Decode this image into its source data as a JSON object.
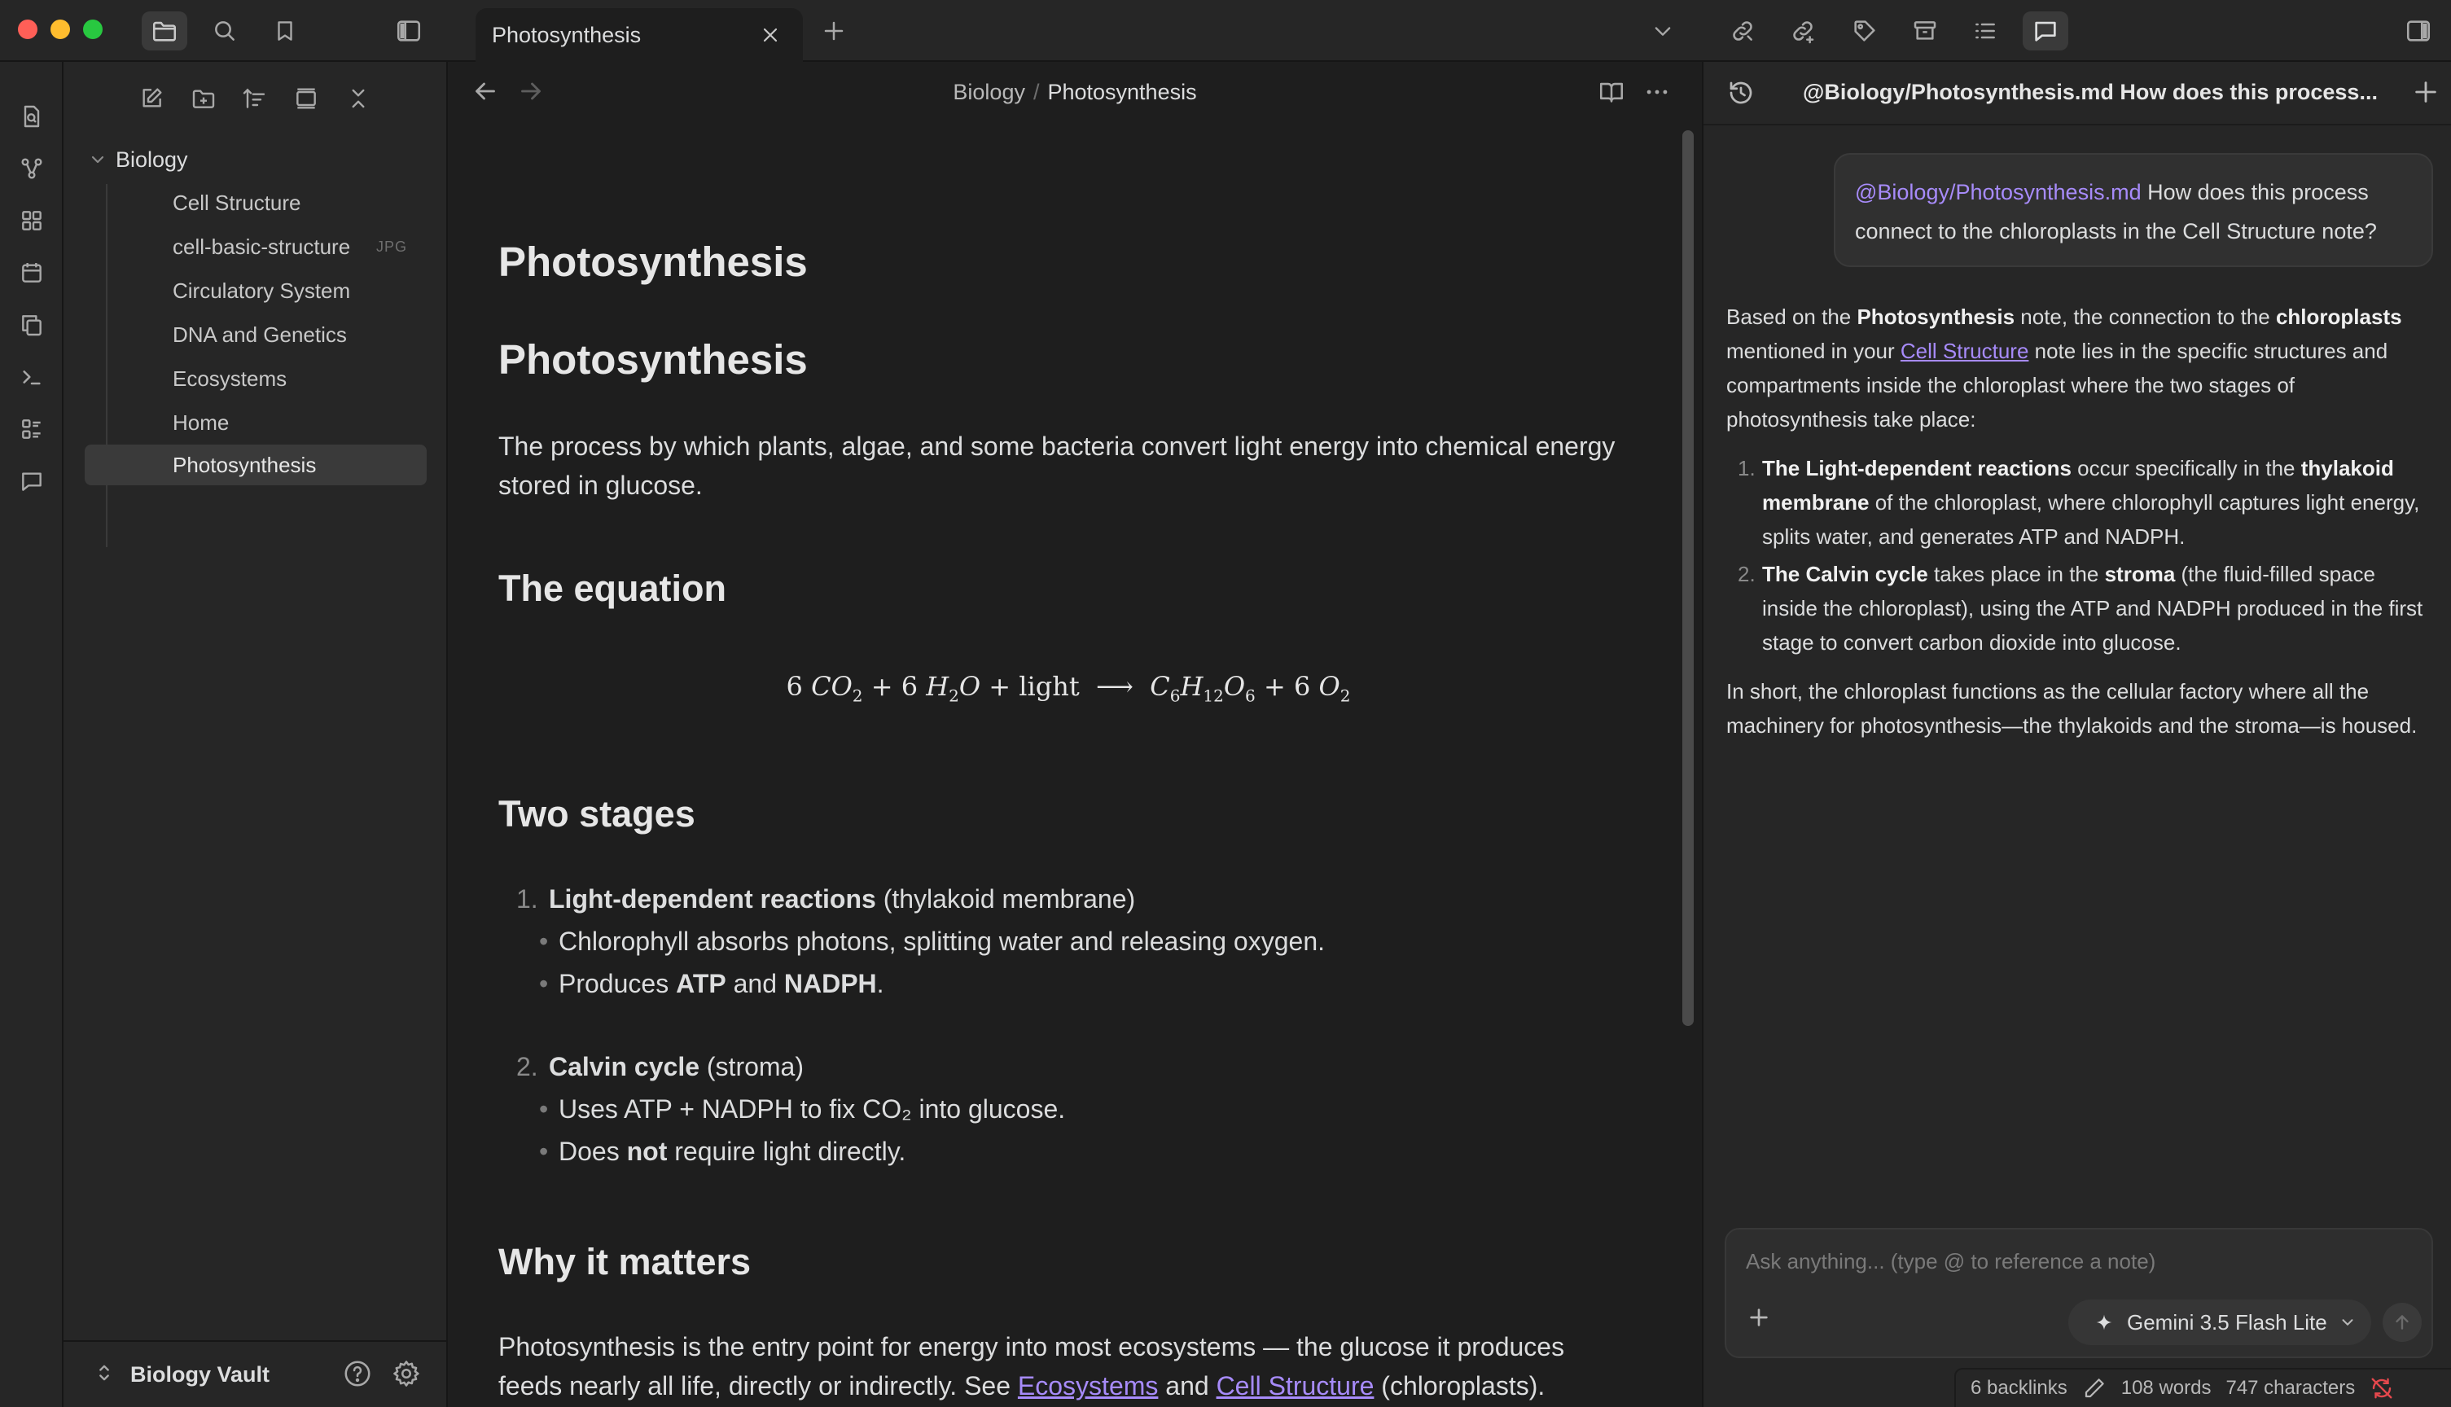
{
  "titlebar": {
    "tab_title": "Photosynthesis"
  },
  "explorer": {
    "folder": "Biology",
    "files": [
      {
        "name": "Cell Structure",
        "badge": ""
      },
      {
        "name": "cell-basic-structure",
        "badge": "JPG"
      },
      {
        "name": "Circulatory System",
        "badge": ""
      },
      {
        "name": "DNA and Genetics",
        "badge": ""
      },
      {
        "name": "Ecosystems",
        "badge": ""
      },
      {
        "name": "Home",
        "badge": ""
      },
      {
        "name": "Photosynthesis",
        "badge": "",
        "selected": true
      }
    ],
    "vault_name": "Biology Vault"
  },
  "editor": {
    "breadcrumb": {
      "folder": "Biology",
      "separator": "/",
      "note": "Photosynthesis"
    },
    "inline_title": "Photosynthesis",
    "h1": "Photosynthesis",
    "intro": "The process by which plants, algae, and some bacteria convert light energy into chemical energy stored in glucose.",
    "equation_heading": "The equation",
    "equation": {
      "lhs_coef1": "6",
      "lhs_mol1": "CO",
      "lhs_mol1_sub": "2",
      "plus1": "+",
      "lhs_coef2": "6",
      "lhs_mol2a": "H",
      "lhs_mol2a_sub": "2",
      "lhs_mol2b": "O",
      "plus2": "+",
      "light": "light",
      "arrow": "⟶",
      "rhs_c": "C",
      "rhs_c_sub": "6",
      "rhs_h": "H",
      "rhs_h_sub": "12",
      "rhs_o": "O",
      "rhs_o_sub": "6",
      "plus3": "+",
      "rhs_coef2": "6",
      "rhs_mol2": "O",
      "rhs_mol2_sub": "2"
    },
    "stages_heading": "Two stages",
    "stage1": {
      "num": "1.",
      "title": "Light-dependent reactions",
      "location": "(thylakoid membrane)",
      "bullet1": "Chlorophyll absorbs photons, splitting water and releasing oxygen.",
      "bullet2_pre": "Produces ",
      "bullet2_atp": "ATP",
      "bullet2_and": " and ",
      "bullet2_nadph": "NADPH",
      "bullet2_end": "."
    },
    "stage2": {
      "num": "2.",
      "title": "Calvin cycle",
      "location": "(stroma)",
      "bullet1": "Uses ATP + NADPH to fix CO₂ into glucose.",
      "bullet2_pre": "Does ",
      "bullet2_not": "not",
      "bullet2_post": " require light directly."
    },
    "matters_heading": "Why it matters",
    "matters_pre": "Photosynthesis is the entry point for energy into most ecosystems — the glucose it produces feeds nearly all life, directly or indirectly. See ",
    "matters_link1": "Ecosystems",
    "matters_and": " and ",
    "matters_link2": "Cell Structure",
    "matters_post": " (chloroplasts)."
  },
  "chat": {
    "title": "@Biology/Photosynthesis.md How does this process...",
    "user_message": {
      "mention": "@Biology/Photosynthesis.md",
      "text": " How does this process connect to the chloroplasts in the Cell Structure note?"
    },
    "answer": {
      "p1_a": "Based on the ",
      "p1_b": "Photosynthesis",
      "p1_c": " note, the connection to the ",
      "p1_d": "chloroplasts",
      "p1_e": " mentioned in your ",
      "p1_link": "Cell Structure",
      "p1_f": " note lies in the specific structures and compartments inside the chloroplast where the two stages of photosynthesis take place:",
      "li1_num": "1.",
      "li1_a": "The Light-dependent reactions",
      "li1_b": " occur specifically in the ",
      "li1_c": "thylakoid membrane",
      "li1_d": " of the chloroplast, where chlorophyll captures light energy, splits water, and generates ATP and NADPH.",
      "li2_num": "2.",
      "li2_a": "The Calvin cycle",
      "li2_b": " takes place in the ",
      "li2_c": "stroma",
      "li2_d": " (the fluid-filled space inside the chloroplast), using the ATP and NADPH produced in the first stage to convert carbon dioxide into glucose.",
      "p2": "In short, the chloroplast functions as the cellular factory where all the machinery for photosynthesis—the thylakoids and the stroma—is housed."
    },
    "input_placeholder": "Ask anything... (type @ to reference a note)",
    "model": "Gemini 3.5 Flash Lite"
  },
  "status": {
    "backlinks": "6 backlinks",
    "words": "108 words",
    "characters": "747 characters"
  },
  "colors": {
    "accent_link": "#a78bfa",
    "background": "#1e1e1e",
    "panel": "#262626",
    "sync_error": "#e5484d"
  }
}
